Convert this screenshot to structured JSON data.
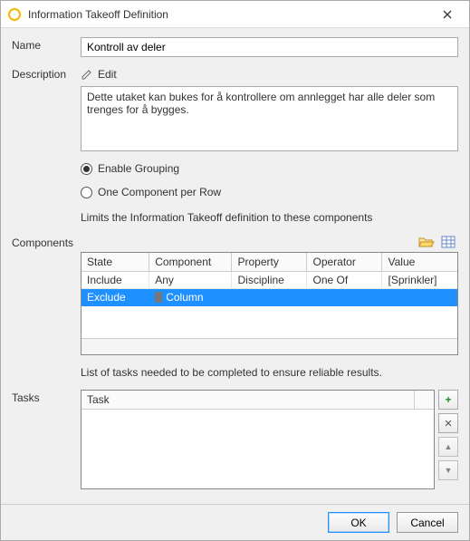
{
  "window": {
    "title": "Information Takeoff Definition",
    "close_tooltip": "Close"
  },
  "labels": {
    "name": "Name",
    "description": "Description",
    "components": "Components",
    "tasks": "Tasks"
  },
  "name": {
    "value": "Kontroll av deler"
  },
  "description": {
    "edit_label": "Edit",
    "text": "Dette utaket kan bukes for å kontrollere om annlegget har alle deler som trenges for å bygges."
  },
  "grouping": {
    "enable_label": "Enable Grouping",
    "one_per_row_label": "One Component per Row",
    "selected": "enable"
  },
  "components": {
    "hint": "Limits the Information Takeoff definition to these components",
    "toolbar_icons": [
      "folder-open-icon",
      "grid-view-icon"
    ],
    "columns": [
      "State",
      "Component",
      "Property",
      "Operator",
      "Value"
    ],
    "rows": [
      {
        "state": "Include",
        "component": "Any",
        "property": "Discipline",
        "operator": "One Of",
        "value": "[Sprinkler]"
      },
      {
        "state": "Exclude",
        "component": "Column",
        "component_icon": "column-icon",
        "property": "",
        "operator": "",
        "value": ""
      }
    ],
    "selected_index": 1
  },
  "tasks": {
    "hint": "List of tasks needed to be completed to ensure reliable results.",
    "columns": [
      "Task"
    ],
    "rows": [],
    "buttons": {
      "add": "+",
      "delete": "×",
      "up": "▲",
      "down": "▼"
    }
  },
  "footer": {
    "ok": "OK",
    "cancel": "Cancel"
  }
}
